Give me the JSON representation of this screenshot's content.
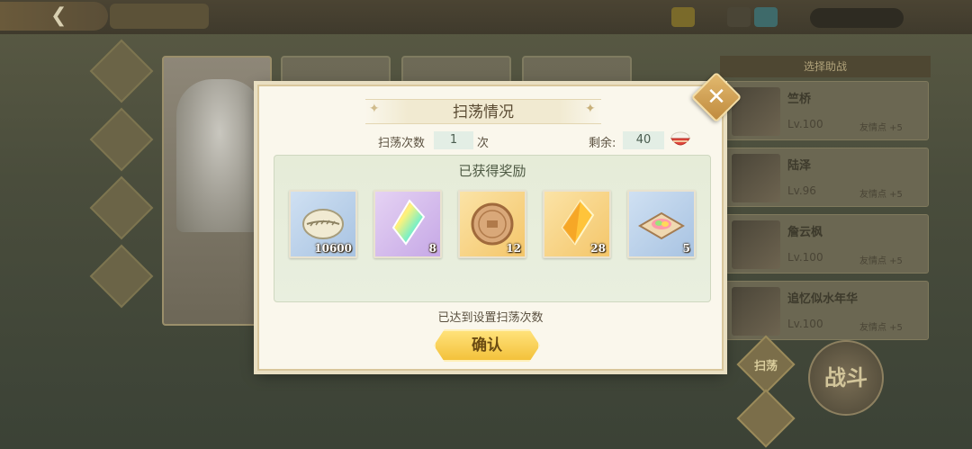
{
  "dialog": {
    "title": "扫荡情况",
    "sweep_count_label": "扫荡次数",
    "sweep_count_value": "1",
    "sweep_count_unit": "次",
    "remaining_label": "剩余:",
    "remaining_value": "40",
    "rewards_heading": "已获得奖励",
    "rewards": [
      {
        "icon": "shell-currency-icon",
        "quantity": "10600",
        "rarity_color": "#a8c3e2"
      },
      {
        "icon": "rainbow-crystal-icon",
        "quantity": "8",
        "rarity_color": "#c6a8e6"
      },
      {
        "icon": "bronze-coin-icon",
        "quantity": "12",
        "rarity_color": "#f4c66a"
      },
      {
        "icon": "gold-crystal-icon",
        "quantity": "28",
        "rarity_color": "#f4c66a"
      },
      {
        "icon": "dumpling-plate-icon",
        "quantity": "5",
        "rarity_color": "#a8c3e2"
      }
    ],
    "status_text": "已达到设置扫荡次数",
    "confirm_label": "确认"
  },
  "background": {
    "friend_list_header": "选择助战",
    "friends": [
      {
        "name": "竺桥",
        "level": "Lv.100",
        "points": "友情点 +5"
      },
      {
        "name": "陆泽",
        "level": "Lv.96",
        "points": "友情点 +5"
      },
      {
        "name": "詹云枫",
        "level": "Lv.100",
        "points": "友情点 +5"
      },
      {
        "name": "追忆似水年华",
        "level": "Lv.100",
        "points": "友情点 +5"
      }
    ],
    "sweep_button_label": "扫荡",
    "battle_button_label": "战斗"
  },
  "colors": {
    "accent_gold": "#f3c23b",
    "dialog_bg": "#faf7ec",
    "panel_green": "#e6ecd8"
  }
}
